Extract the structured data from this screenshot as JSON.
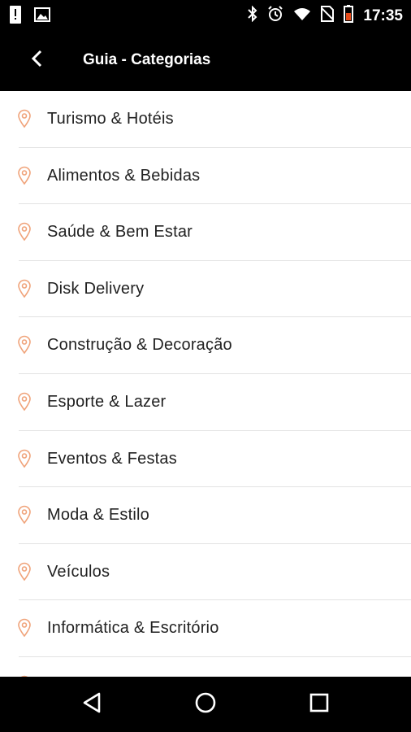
{
  "status_bar": {
    "time": "17:35",
    "icons": [
      "alert-icon",
      "image-icon",
      "bluetooth-icon",
      "alarm-icon",
      "wifi-icon",
      "no-sim-icon",
      "battery-low-icon"
    ]
  },
  "app_bar": {
    "title": "Guia - Categorias",
    "back_icon": "chevron-left-icon"
  },
  "categories": [
    {
      "label": "Turismo & Hotéis"
    },
    {
      "label": "Alimentos & Bebidas"
    },
    {
      "label": "Saúde & Bem Estar"
    },
    {
      "label": "Disk Delivery"
    },
    {
      "label": "Construção & Decoração"
    },
    {
      "label": "Esporte & Lazer"
    },
    {
      "label": "Eventos & Festas"
    },
    {
      "label": "Moda & Estilo"
    },
    {
      "label": "Veículos"
    },
    {
      "label": "Informática & Escritório"
    },
    {
      "label": ""
    }
  ],
  "colors": {
    "accent_pin": "#f0a37a",
    "bar_background": "#000000",
    "text": "#222222"
  },
  "nav_bar": {
    "icons": [
      "back-triangle-icon",
      "home-circle-icon",
      "recents-square-icon"
    ]
  }
}
